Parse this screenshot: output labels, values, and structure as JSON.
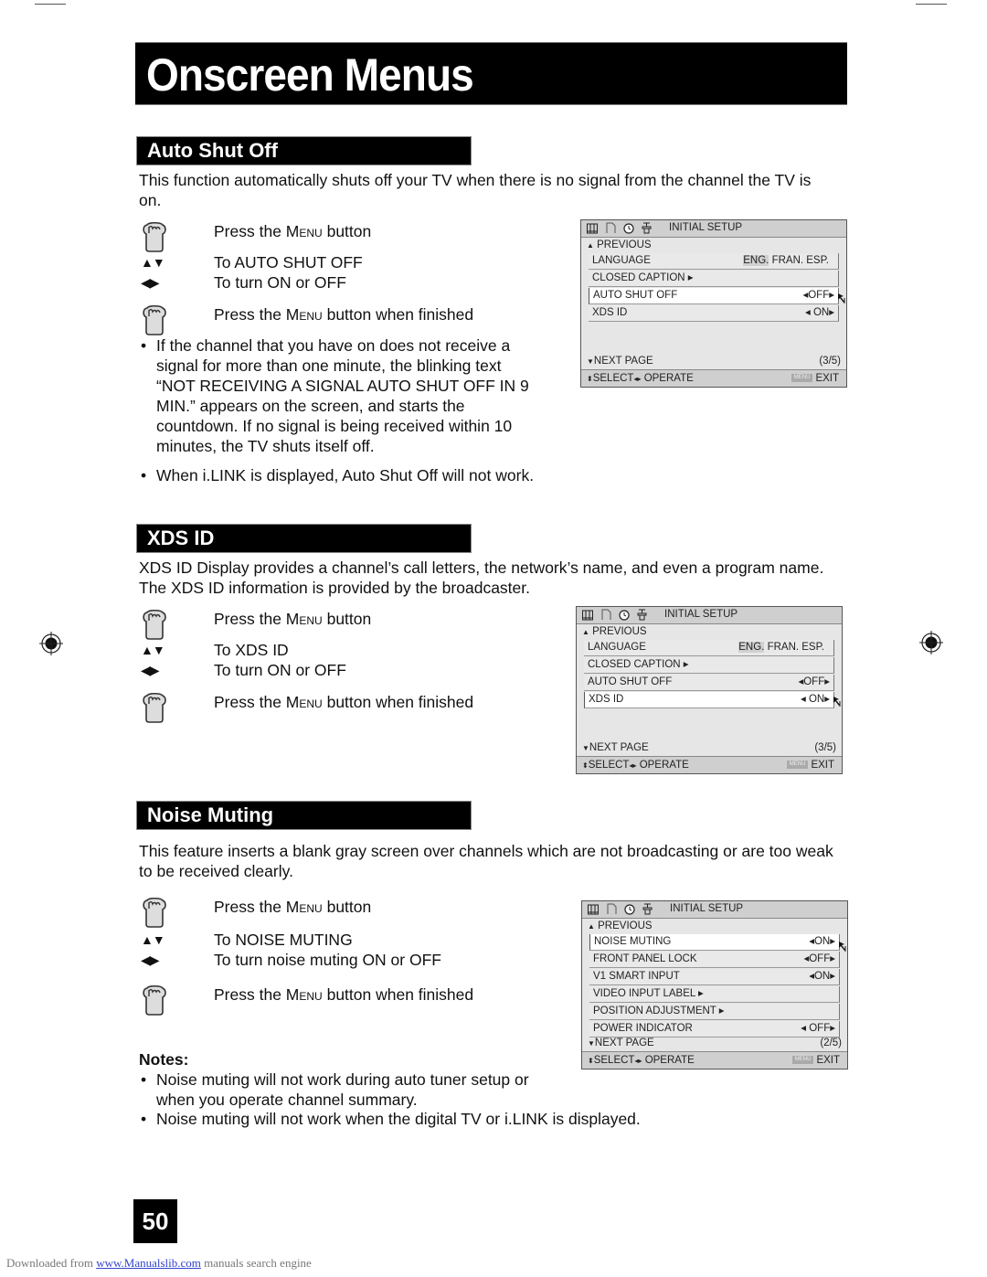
{
  "page": {
    "title": "Onscreen Menus",
    "page_number": "50",
    "footer": {
      "prefix": "Downloaded from ",
      "link": "www.Manualslib.com",
      "suffix": " manuals search engine"
    }
  },
  "sections": [
    {
      "heading": "Auto Shut Off",
      "intro": "This function automatically shuts off your TV when there is no signal from the channel the TV is on.",
      "steps": {
        "press_menu_pre": "Press the ",
        "menu_word": "Menu",
        "press_menu_post": " button",
        "updown": "To AUTO SHUT OFF",
        "leftright": "To turn ON or OFF",
        "finished_post": " button when finished"
      },
      "bullets": [
        "If the channel that you have on does not receive a signal for more than one minute, the blinking text “NOT RECEIVING A SIGNAL AUTO SHUT OFF IN 9 MIN.” appears on the screen, and starts the countdown. If no signal is being received within 10 minutes, the TV shuts itself off.",
        "When i.LINK is displayed, Auto Shut Off will not work."
      ],
      "osd": {
        "title": "INITIAL SETUP",
        "previous": "PREVIOUS",
        "rows": [
          {
            "label": "LANGUAGE",
            "value": "",
            "lang": [
              "ENG.",
              " FRAN. ESP."
            ]
          },
          {
            "label": "CLOSED CAPTION ▸",
            "value": ""
          },
          {
            "label": "AUTO SHUT OFF",
            "value": "◂OFF▸"
          },
          {
            "label": "XDS ID",
            "value": "◂ ON▸"
          }
        ],
        "selected_index": 2,
        "next": "NEXT PAGE",
        "page": "(3/5)",
        "select": "SELECT",
        "operate": "OPERATE",
        "menu_chip": "MENU",
        "exit": "EXIT"
      }
    },
    {
      "heading": "XDS ID",
      "intro": "XDS ID Display provides a channel’s call letters, the network’s name, and even a program name. The XDS ID information is provided by the broadcaster.",
      "steps": {
        "press_menu_pre": "Press the ",
        "menu_word": "Menu",
        "press_menu_post": " button",
        "updown": "To XDS ID",
        "leftright": "To turn ON or OFF",
        "finished_post": " button when finished"
      },
      "osd": {
        "title": "INITIAL SETUP",
        "previous": "PREVIOUS",
        "rows": [
          {
            "label": "LANGUAGE",
            "value": "",
            "lang": [
              "ENG.",
              " FRAN. ESP."
            ]
          },
          {
            "label": "CLOSED CAPTION ▸",
            "value": ""
          },
          {
            "label": "AUTO SHUT OFF",
            "value": "◂OFF▸"
          },
          {
            "label": "XDS ID",
            "value": "◂ ON▸"
          }
        ],
        "selected_index": 3,
        "next": "NEXT PAGE",
        "page": "(3/5)",
        "select": "SELECT",
        "operate": "OPERATE",
        "menu_chip": "MENU",
        "exit": "EXIT"
      }
    },
    {
      "heading": "Noise Muting",
      "intro": "This feature inserts a blank gray screen over channels which are not broadcasting or are too weak to be received clearly.",
      "steps": {
        "press_menu_pre": "Press the ",
        "menu_word": "Menu",
        "press_menu_post": " button",
        "updown": "To NOISE MUTING",
        "leftright": "To turn noise muting ON or OFF",
        "finished_post": " button when finished"
      },
      "notes_label": "Notes:",
      "bullets": [
        "Noise muting will not work during auto tuner setup or when you operate channel summary.",
        "Noise muting will not work when the digital TV or i.LINK is displayed."
      ],
      "osd": {
        "title": "INITIAL SETUP",
        "previous": "PREVIOUS",
        "rows": [
          {
            "label": "NOISE MUTING",
            "value": "◂ON▸"
          },
          {
            "label": "FRONT PANEL LOCK",
            "value": "◂OFF▸"
          },
          {
            "label": "V1 SMART INPUT",
            "value": "◂ON▸"
          },
          {
            "label": "VIDEO INPUT LABEL ▸",
            "value": ""
          },
          {
            "label": "POSITION ADJUSTMENT ▸",
            "value": ""
          },
          {
            "label": "POWER INDICATOR",
            "value": "◂ OFF▸"
          }
        ],
        "selected_index": 0,
        "next": "NEXT PAGE",
        "page": "(2/5)",
        "select": "SELECT",
        "operate": "OPERATE",
        "menu_chip": "MENU",
        "exit": "EXIT"
      }
    }
  ]
}
